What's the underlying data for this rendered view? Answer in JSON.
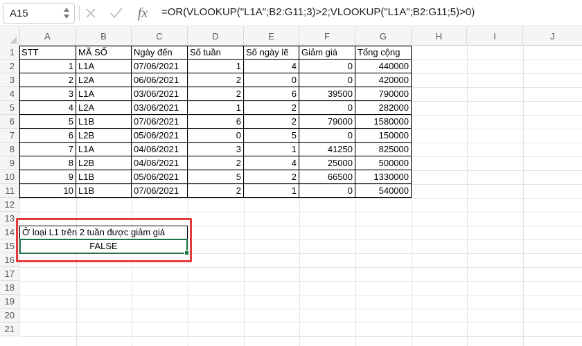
{
  "formula_bar": {
    "name_box": "A15",
    "cancel_icon": "close-icon",
    "confirm_icon": "checkmark-icon",
    "function_label": "fx",
    "formula": "=OR(VLOOKUP(\"L1A\";B2:G11;3)>2;VLOOKUP(\"L1A\";B2:G11;5)>0)"
  },
  "columns": [
    "A",
    "B",
    "C",
    "D",
    "E",
    "F",
    "G",
    "H",
    "I",
    "J"
  ],
  "rows": [
    "1",
    "2",
    "3",
    "4",
    "5",
    "6",
    "7",
    "8",
    "9",
    "10",
    "11",
    "12",
    "13",
    "14",
    "15",
    "16",
    "17",
    "18",
    "19",
    "20",
    "21"
  ],
  "table": {
    "headers": [
      "STT",
      "MÃ SỐ",
      "Ngày đến",
      "Số tuần",
      "Số ngày lẽ",
      "Giảm giá",
      "Tổng cộng"
    ],
    "rows": [
      [
        "1",
        "L1A",
        "07/06/2021",
        "1",
        "4",
        "0",
        "440000"
      ],
      [
        "2",
        "L2A",
        "06/06/2021",
        "2",
        "0",
        "0",
        "420000"
      ],
      [
        "3",
        "L1A",
        "03/06/2021",
        "2",
        "6",
        "39500",
        "790000"
      ],
      [
        "4",
        "L2A",
        "03/06/2021",
        "1",
        "2",
        "0",
        "282000"
      ],
      [
        "5",
        "L1B",
        "07/06/2021",
        "6",
        "2",
        "79000",
        "1580000"
      ],
      [
        "6",
        "L2B",
        "05/06/2021",
        "0",
        "5",
        "0",
        "150000"
      ],
      [
        "7",
        "L1A",
        "04/06/2021",
        "3",
        "1",
        "41250",
        "825000"
      ],
      [
        "8",
        "L2B",
        "04/06/2021",
        "2",
        "4",
        "25000",
        "500000"
      ],
      [
        "9",
        "L1B",
        "05/06/2021",
        "5",
        "2",
        "66500",
        "1330000"
      ],
      [
        "10",
        "L1B",
        "07/06/2021",
        "2",
        "1",
        "0",
        "540000"
      ]
    ]
  },
  "note_cell": "Ở loại L1 trên 2 tuần được giảm giá",
  "result_cell": "FALSE",
  "colors": {
    "selection": "#217346",
    "highlight": "#e5393b"
  }
}
